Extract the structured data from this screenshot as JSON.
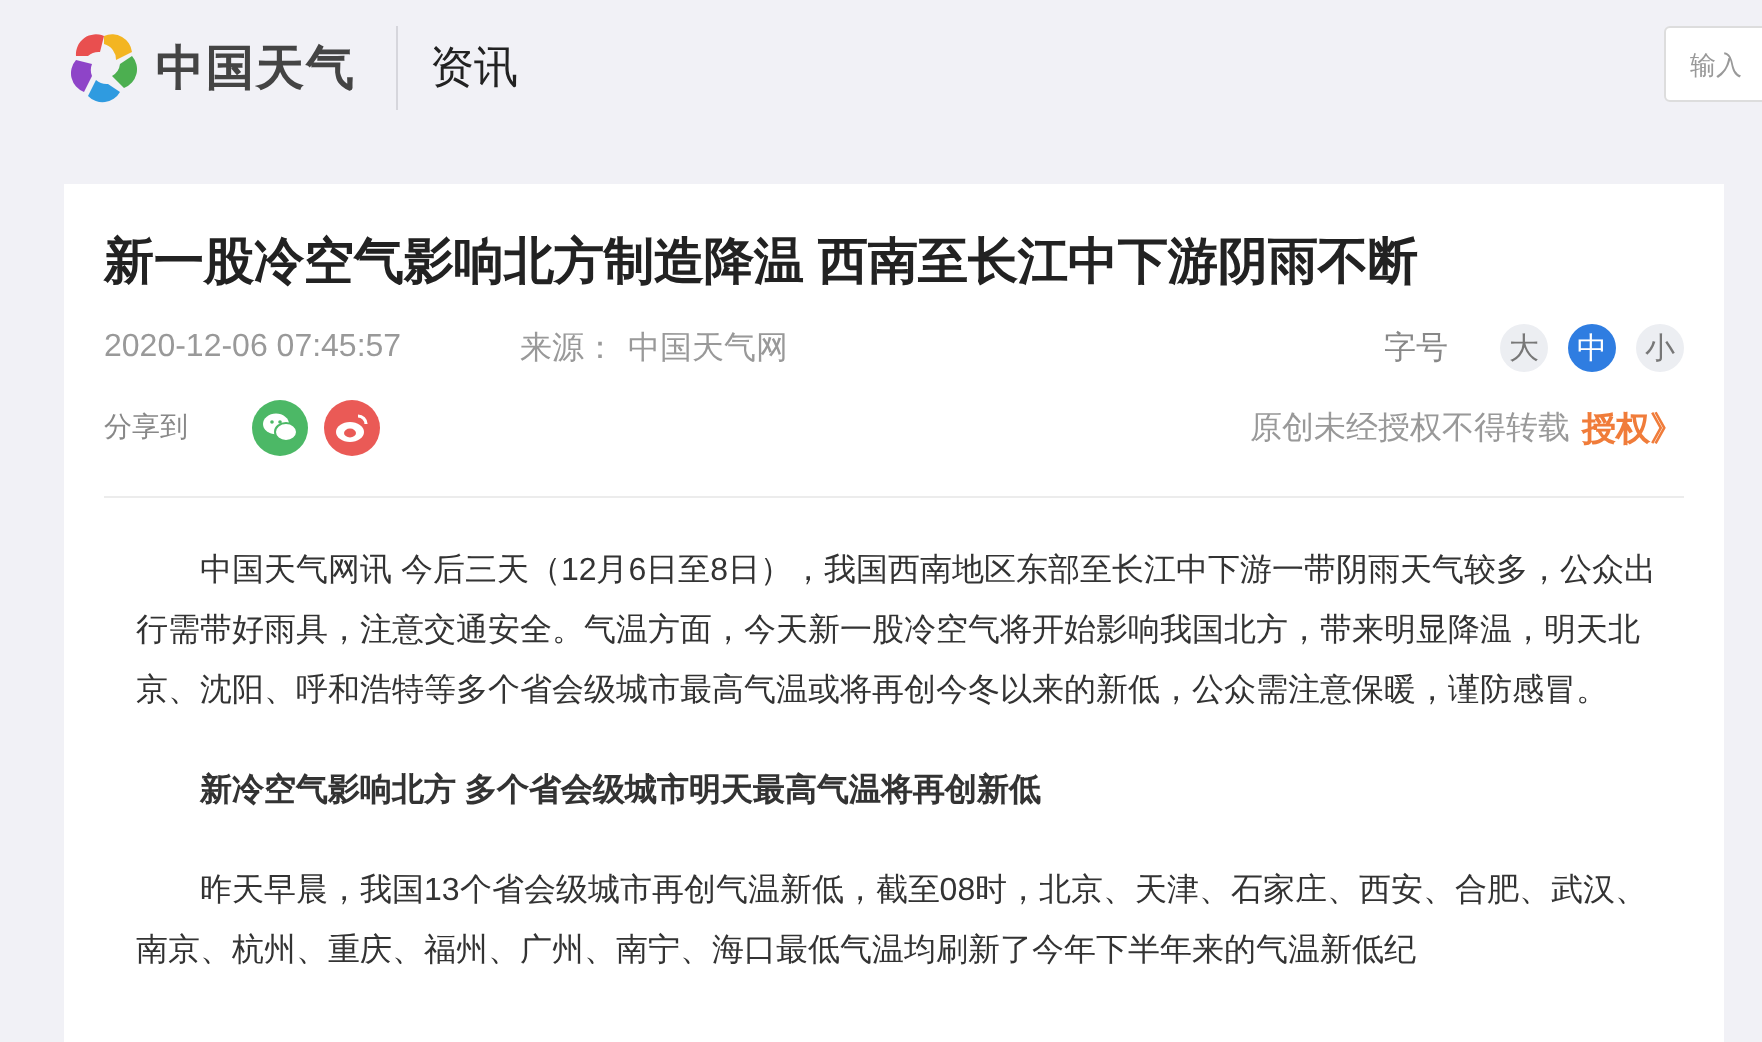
{
  "header": {
    "brand": "中国天气",
    "section": "资讯",
    "search": {
      "placeholder": "输入"
    }
  },
  "article": {
    "title": "新一股冷空气影响北方制造降温 西南至长江中下游阴雨不断",
    "date": "2020-12-06 07:45:57",
    "source_label": "来源：",
    "source": "中国天气网",
    "font_size_label": "字号",
    "font_sizes": [
      {
        "label": "大",
        "selected": false
      },
      {
        "label": "中",
        "selected": true
      },
      {
        "label": "小",
        "selected": false
      }
    ],
    "share_label": "分享到",
    "share": [
      {
        "kind": "wechat",
        "color": "#4cb866"
      },
      {
        "kind": "weibo",
        "color": "#ea5a56"
      }
    ],
    "copyright": "原创未经授权不得转载",
    "license_link": "授权》",
    "body": [
      {
        "kind": "paragraph",
        "text": "中国天气网讯 今后三天（12月6日至8日），我国西南地区东部至长江中下游一带阴雨天气较多，公众出行需带好雨具，注意交通安全。气温方面，今天新一股冷空气将开始影响我国北方，带来明显降温，明天北京、沈阳、呼和浩特等多个省会级城市最高气温或将再创今冬以来的新低，公众需注意保暖，谨防感冒。"
      },
      {
        "kind": "heading",
        "text": "新冷空气影响北方 多个省会级城市明天最高气温将再创新低"
      },
      {
        "kind": "paragraph",
        "text": "昨天早晨，我国13个省会级城市再创气温新低，截至08时，北京、天津、石家庄、西安、合肥、武汉、南京、杭州、重庆、福州、广州、南宁、海口最低气温均刷新了今年下半年来的气温新低纪"
      }
    ]
  }
}
